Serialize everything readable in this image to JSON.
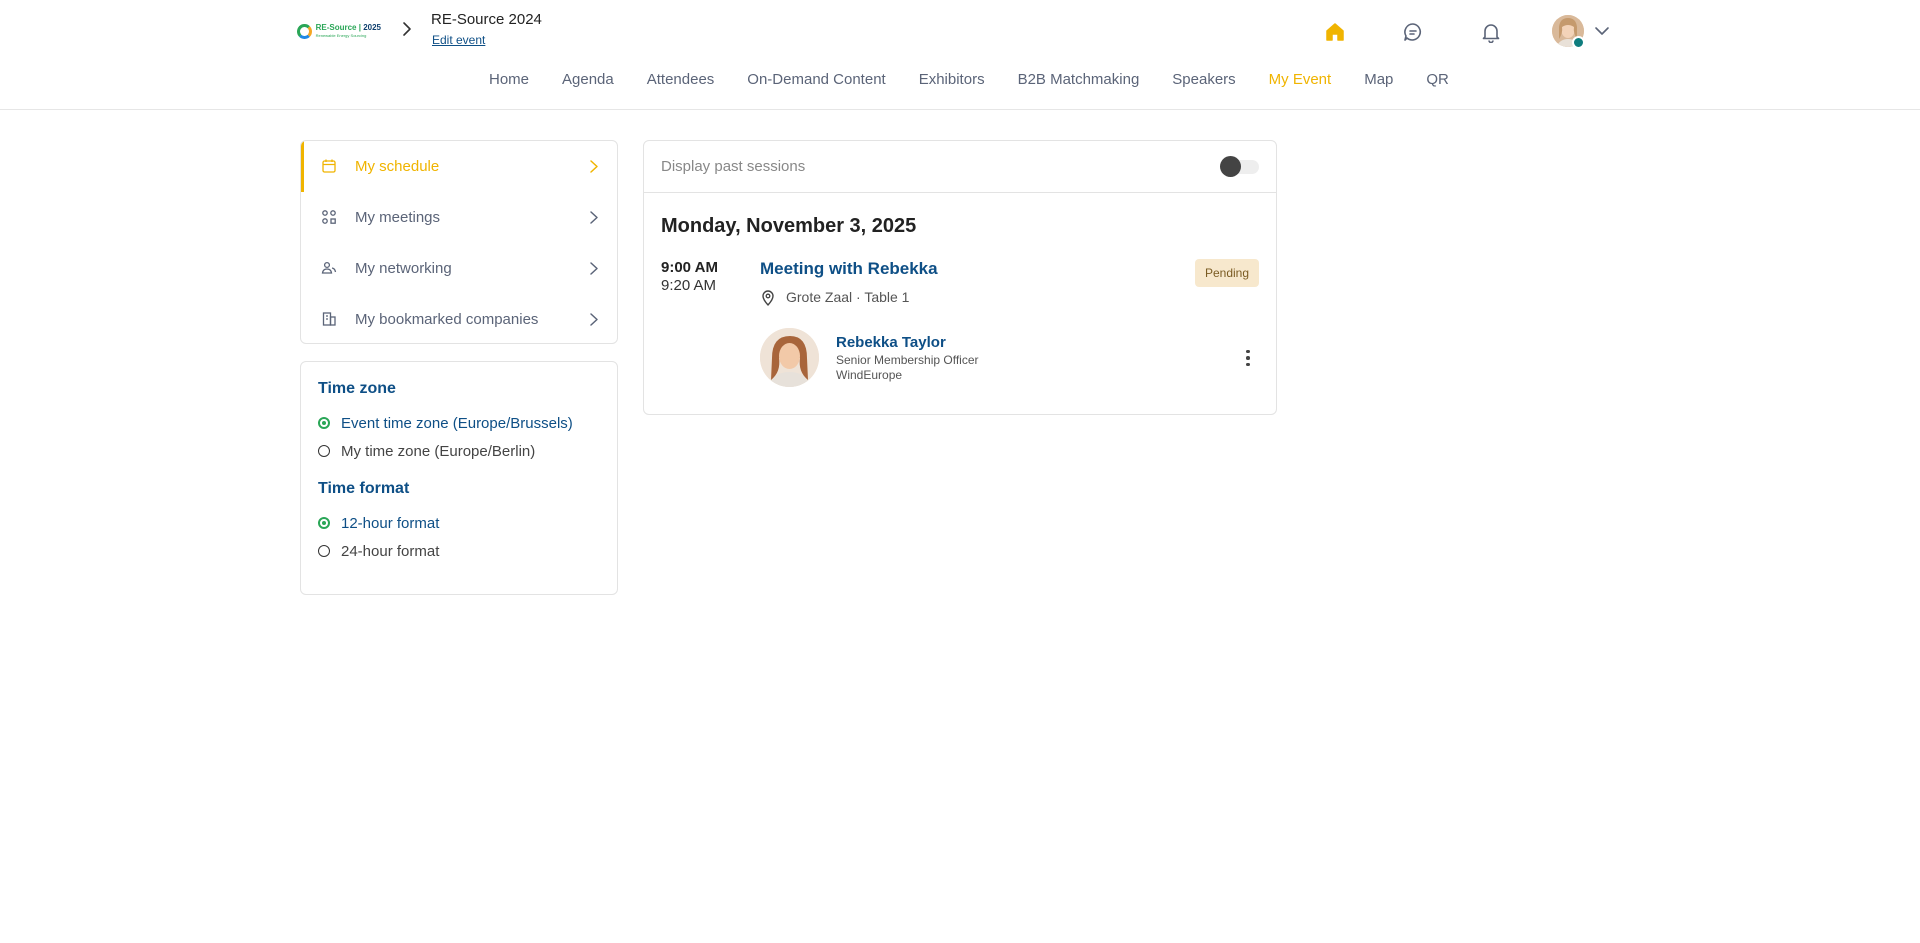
{
  "header": {
    "logo": {
      "name_part1": "RE-Source",
      "name_part2": "2025",
      "subtitle": "Renewable Energy Sourcing"
    },
    "event_title": "RE-Source 2024",
    "edit_event": "Edit event",
    "icons": [
      "home-icon",
      "chat-icon",
      "bell-icon"
    ],
    "accent_color": "#f0b400"
  },
  "nav": {
    "items": [
      "Home",
      "Agenda",
      "Attendees",
      "On-Demand Content",
      "Exhibitors",
      "B2B Matchmaking",
      "Speakers",
      "My Event",
      "Map",
      "QR"
    ],
    "active": "My Event"
  },
  "side_menu": {
    "items": [
      {
        "label": "My schedule",
        "icon": "calendar-icon",
        "active": true
      },
      {
        "label": "My meetings",
        "icon": "meetings-icon",
        "active": false
      },
      {
        "label": "My networking",
        "icon": "networking-icon",
        "active": false
      },
      {
        "label": "My bookmarked companies",
        "icon": "building-icon",
        "active": false
      }
    ]
  },
  "time_settings": {
    "timezone_heading": "Time zone",
    "timezone_options": [
      {
        "label": "Event time zone (Europe/Brussels)",
        "selected": true
      },
      {
        "label": "My time zone (Europe/Berlin)",
        "selected": false
      }
    ],
    "format_heading": "Time format",
    "format_options": [
      {
        "label": "12-hour format",
        "selected": true
      },
      {
        "label": "24-hour format",
        "selected": false
      }
    ]
  },
  "schedule": {
    "past_sessions_label": "Display past sessions",
    "past_sessions_on": false,
    "day": "Monday, November 3, 2025",
    "session": {
      "start": "9:00 AM",
      "end": "9:20 AM",
      "title": "Meeting with Rebekka",
      "location": "Grote Zaal · Table 1",
      "status": "Pending",
      "person": {
        "name": "Rebekka Taylor",
        "role": "Senior Membership Officer",
        "organization": "WindEurope"
      }
    }
  }
}
